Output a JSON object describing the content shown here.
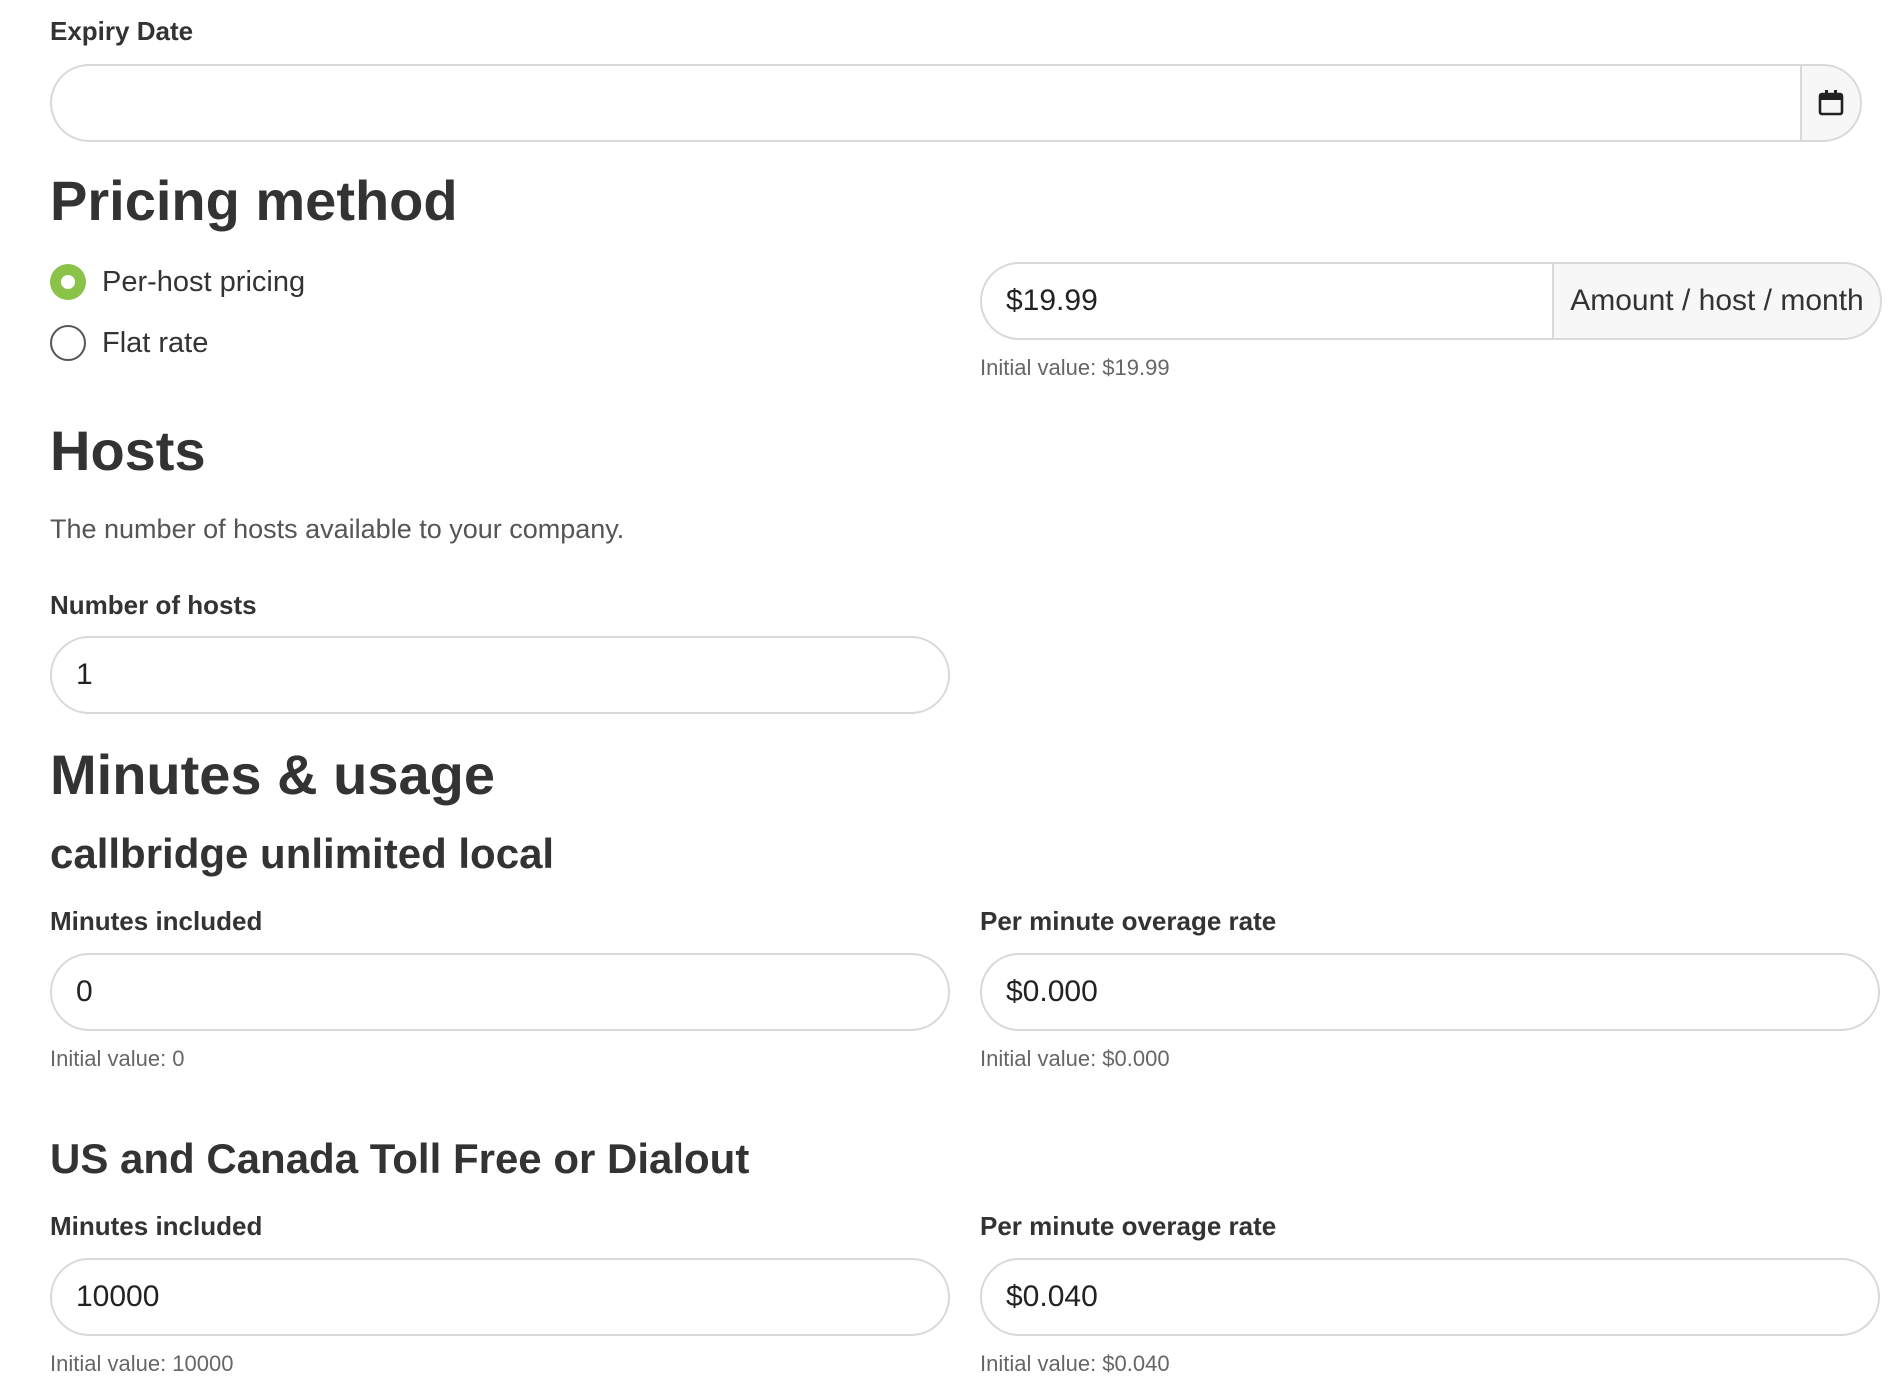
{
  "expiry": {
    "label": "Expiry Date",
    "value": "",
    "calendar_icon": "calendar-icon"
  },
  "pricing": {
    "heading": "Pricing method",
    "options": [
      {
        "label": "Per-host pricing",
        "checked": true
      },
      {
        "label": "Flat rate",
        "checked": false
      }
    ],
    "amount_value": "$19.99",
    "amount_unit": "Amount / host / month",
    "amount_help": "Initial value: $19.99",
    "accent_color": "#8bc34a"
  },
  "hosts": {
    "heading": "Hosts",
    "description": "The number of hosts available to your company.",
    "label": "Number of hosts",
    "value": "1"
  },
  "usage": {
    "heading": "Minutes & usage",
    "groups": [
      {
        "title": "callbridge unlimited local",
        "minutes_label": "Minutes included",
        "minutes_value": "0",
        "minutes_help": "Initial value: 0",
        "rate_label": "Per minute overage rate",
        "rate_value": "$0.000",
        "rate_help": "Initial value: $0.000"
      },
      {
        "title": "US and Canada Toll Free or Dialout",
        "minutes_label": "Minutes included",
        "minutes_value": "10000",
        "minutes_help": "Initial value: 10000",
        "rate_label": "Per minute overage rate",
        "rate_value": "$0.040",
        "rate_help": "Initial value: $0.040"
      }
    ]
  }
}
